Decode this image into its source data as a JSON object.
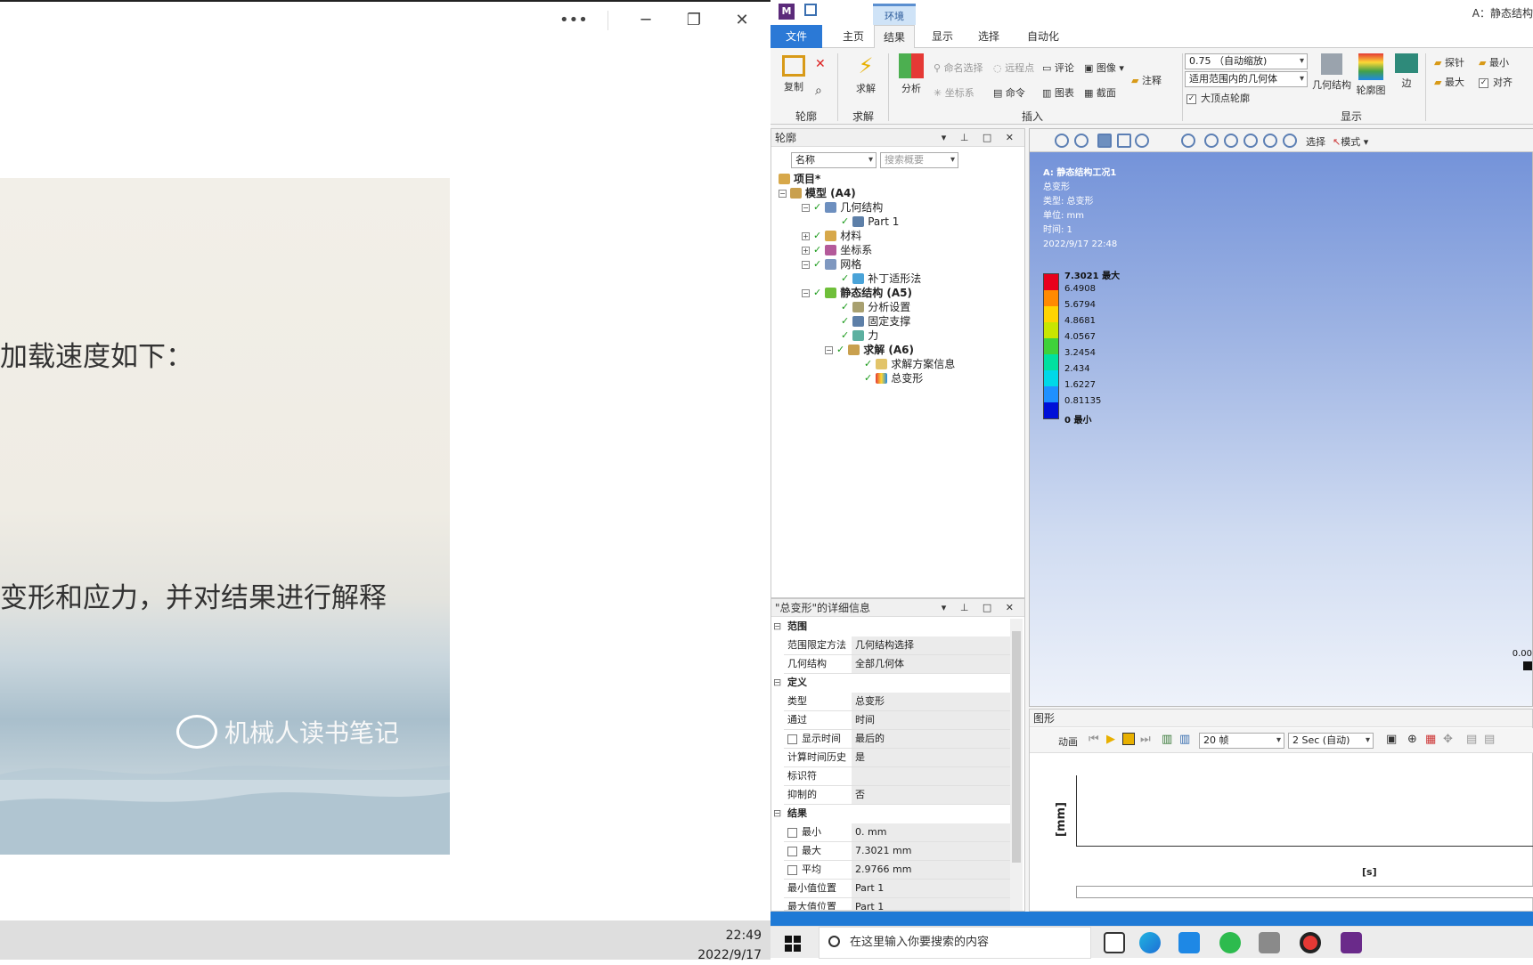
{
  "left_viewer": {
    "more_icon": "more-icon",
    "line1": "加载速度如下：",
    "line2": "变形和应力，并对结果进行解释",
    "watermark": "机械人读书笔记",
    "time": "22:49",
    "date": "2022/9/17"
  },
  "app": {
    "logo": "M",
    "context_tab": "环境",
    "title": "A：静态结构",
    "tabs": [
      "文件",
      "主页",
      "结果",
      "显示",
      "选择",
      "自动化"
    ],
    "active_tab": "结果",
    "ribbon": {
      "copy": "复制",
      "solve": "求解",
      "analysis": "分析",
      "named_sel": "命名选择",
      "remote_pt": "远程点",
      "comment": "评论",
      "image": "图像",
      "coord": "坐标系",
      "command": "命令",
      "chart": "图表",
      "section": "截面",
      "annotation": "注释",
      "scale_value": "0.75 （自动缩放)",
      "scope_value": "适用范围内的几何体",
      "vertex_label": "大顶点轮廓",
      "geometry": "几何结构",
      "contour": "轮廓图",
      "edge": "边",
      "probe": "探针",
      "min": "最小",
      "max": "最大",
      "align": "对齐",
      "groups": {
        "outline": "轮廓",
        "solve": "求解",
        "insert": "插入",
        "display": "显示"
      }
    },
    "outline": {
      "title": "轮廓",
      "filter_combo": "名称",
      "search_placeholder": "搜索概要",
      "tree": [
        {
          "label": "项目*",
          "bold": true
        },
        {
          "label": "模型 (A4)",
          "bold": true
        },
        {
          "label": "几何结构"
        },
        {
          "label": "Part 1"
        },
        {
          "label": "材料"
        },
        {
          "label": "坐标系"
        },
        {
          "label": "网格"
        },
        {
          "label": "补丁适形法"
        },
        {
          "label": "静态结构 (A5)",
          "bold": true
        },
        {
          "label": "分析设置"
        },
        {
          "label": "固定支撑"
        },
        {
          "label": "力"
        },
        {
          "label": "求解 (A6)",
          "bold": true
        },
        {
          "label": "求解方案信息"
        },
        {
          "label": "总变形"
        }
      ]
    },
    "details": {
      "title": "\"总变形\"的详细信息",
      "sec_scope": "范围",
      "sec_def": "定义",
      "sec_res": "结果",
      "rows": [
        {
          "k": "范围限定方法",
          "v": "几何结构选择"
        },
        {
          "k": "几何结构",
          "v": "全部几何体"
        },
        {
          "k": "类型",
          "v": "总变形"
        },
        {
          "k": "通过",
          "v": "时间"
        },
        {
          "k": "显示时间",
          "v": "最后的"
        },
        {
          "k": "计算时间历史",
          "v": "是"
        },
        {
          "k": "标识符",
          "v": ""
        },
        {
          "k": "抑制的",
          "v": "否"
        },
        {
          "k": "最小",
          "v": "0. mm"
        },
        {
          "k": "最大",
          "v": "7.3021 mm"
        },
        {
          "k": "平均",
          "v": "2.9766 mm"
        },
        {
          "k": "最小值位置",
          "v": "Part 1"
        },
        {
          "k": "最大值位置",
          "v": "Part 1"
        }
      ]
    },
    "graphics": {
      "toolbar_select": "选择",
      "toolbar_mode": "模式",
      "info": [
        "A: 静态结构工况1",
        "总变形",
        "类型: 总变形",
        "单位: mm",
        "时间: 1",
        "2022/9/17 22:48"
      ],
      "legend": [
        "7.3021 最大",
        "6.4908",
        "5.6794",
        "4.8681",
        "4.0567",
        "3.2454",
        "2.434",
        "1.6227",
        "0.81135",
        "0 最小"
      ],
      "scale_label": "0.00"
    },
    "graph": {
      "title": "图形",
      "animation": "动画",
      "frames": "20 帧",
      "duration": "2 Sec (自动)",
      "ylabel": "[mm]",
      "xlabel": "[s]"
    }
  },
  "taskbar": {
    "search_placeholder": "在这里输入你要搜索的内容"
  }
}
